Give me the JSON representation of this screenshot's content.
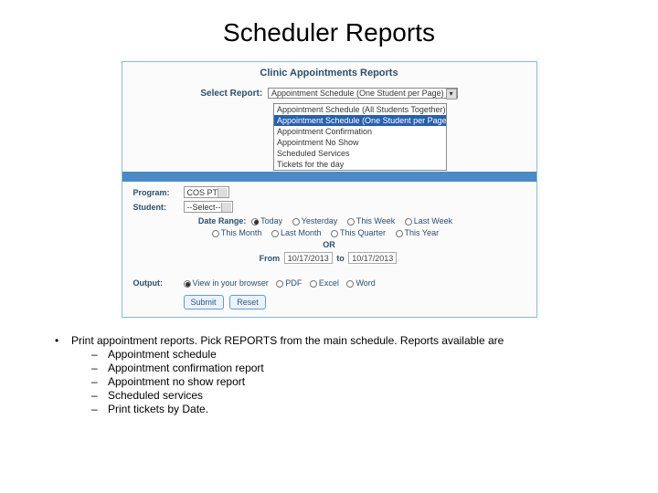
{
  "title": "Scheduler Reports",
  "panel": {
    "heading": "Clinic Appointments Reports",
    "selectReport": {
      "label": "Select Report:",
      "value": "Appointment Schedule (One Student per Page)",
      "options": [
        "Appointment Schedule (All Students Together)",
        "Appointment Schedule (One Student per Page)",
        "Appointment Confirmation",
        "Appointment No Show",
        "Scheduled Services",
        "Tickets for the day"
      ]
    },
    "program": {
      "label": "Program:",
      "value": "COS PT"
    },
    "student": {
      "label": "Student:",
      "value": "--Select--"
    },
    "dateRange": {
      "label": "Date Range:",
      "options1": [
        "Today",
        "Yesterday",
        "This Week",
        "Last Week"
      ],
      "options2": [
        "This Month",
        "Last Month",
        "This Quarter",
        "This Year"
      ],
      "selected": "Today",
      "or": "OR",
      "fromLabel": "From",
      "fromValue": "10/17/2013",
      "toLabel": "to",
      "toValue": "10/17/2013"
    },
    "output": {
      "label": "Output:",
      "options": [
        "View in your browser",
        "PDF",
        "Excel",
        "Word"
      ],
      "selected": "View in your browser"
    },
    "buttons": {
      "submit": "Submit",
      "reset": "Reset"
    }
  },
  "notes": {
    "line1": "Print appointment reports. Pick REPORTS from the main schedule. Reports available are",
    "items": [
      "Appointment schedule",
      "Appointment confirmation report",
      "Appointment no show report",
      "Scheduled services",
      "Print tickets by Date."
    ]
  }
}
